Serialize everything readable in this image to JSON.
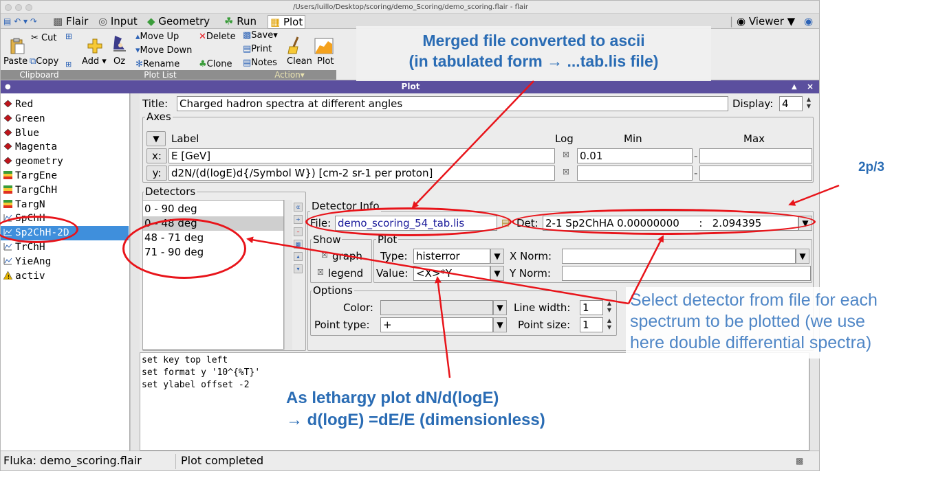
{
  "window": {
    "title": "/Users/luillo/Desktop/scoring/demo_Scoring/demo_scoring.flair - flair",
    "panel_title": "Plot"
  },
  "menubar": {
    "items": [
      "Flair",
      "Input",
      "Geometry",
      "Run",
      "Plot"
    ],
    "viewer": "Viewer"
  },
  "ribbon": {
    "clipboard": {
      "cut": "Cut",
      "paste": "Paste",
      "copy": "Copy",
      "label": "Clipboard"
    },
    "plotlist": {
      "add": "Add",
      "oz": "Oz",
      "move_up": "Move Up",
      "move_down": "Move Down",
      "rename": "Rename",
      "delete": "Delete",
      "clone": "Clone",
      "label": "Plot List"
    },
    "action": {
      "save": "Save",
      "print": "Print",
      "notes": "Notes",
      "clean": "Clean",
      "plot": "Plot",
      "label": "Action"
    }
  },
  "plot_list": [
    {
      "label": "Red",
      "icon": "red-dot-icon",
      "color": "#c0141b"
    },
    {
      "label": "Green",
      "icon": "green-dot-icon",
      "color": "#c0141b"
    },
    {
      "label": "Blue",
      "icon": "blue-dot-icon",
      "color": "#c0141b"
    },
    {
      "label": "Magenta",
      "icon": "magenta-dot-icon",
      "color": "#c0141b"
    },
    {
      "label": "geometry",
      "icon": "geometry-dot-icon",
      "color": "#c0141b"
    },
    {
      "label": "TargEne",
      "icon": "usrbin-icon",
      "color": "#e03020"
    },
    {
      "label": "TargChH",
      "icon": "usrbin-icon",
      "color": "#e03020"
    },
    {
      "label": "TargN",
      "icon": "usrbin-icon",
      "color": "#e03020"
    },
    {
      "label": "SpChH",
      "icon": "line-plot-icon",
      "color": "#2d63b6"
    },
    {
      "label": "Sp2ChH-2D",
      "icon": "line-plot-icon",
      "color": "#2d63b6"
    },
    {
      "label": "TrChH",
      "icon": "line-plot-icon",
      "color": "#2d63b6"
    },
    {
      "label": "YieAng",
      "icon": "line-plot-icon",
      "color": "#2d63b6"
    },
    {
      "label": "activ",
      "icon": "warning-icon",
      "color": "#e0b000"
    }
  ],
  "plot_form": {
    "title_label": "Title:",
    "title_value": "Charged hadron spectra at different angles",
    "display_label": "Display:",
    "display_value": "4",
    "axes": {
      "frame_label": "Axes",
      "col_label": "Label",
      "col_log": "Log",
      "col_min": "Min",
      "col_max": "Max",
      "x_label": "x:",
      "x_value": "E [GeV]",
      "x_min": "0.01",
      "y_label": "y:",
      "y_value": "d2N/(d(logE)d{/Symbol W}) [cm-2 sr-1 per proton]"
    },
    "detectors": {
      "frame_label": "Detectors",
      "items": [
        "0 - 90 deg",
        "0 - 48 deg",
        "48 - 71 deg",
        "71 - 90 deg"
      ]
    },
    "detector_info": {
      "frame_label": "Detector Info",
      "file_label": "File:",
      "file_value": "demo_scoring_54_tab.lis",
      "det_label": "Det:",
      "det_value": "2-1 Sp2ChHA 0.00000000      :   2.094395",
      "show_label": "Show",
      "graph": "graph",
      "legend": "legend",
      "plot_label": "Plot",
      "type_label": "Type:",
      "type_value": "histerror",
      "value_label": "Value:",
      "value_value": "<X>*Y",
      "xnorm_label": "X Norm:",
      "ynorm_label": "Y Norm:",
      "options_label": "Options",
      "color_label": "Color:",
      "linewidth_label": "Line width:",
      "linewidth_value": "1",
      "pointtype_label": "Point type:",
      "pointtype_value": "+",
      "pointsize_label": "Point size:",
      "pointsize_value": "1"
    },
    "commands": [
      "set key top left",
      "set format y '10^{%T}'",
      "set ylabel offset -2"
    ]
  },
  "status": {
    "file": "Fluka: demo_scoring.flair",
    "message": "Plot completed"
  },
  "annotations": {
    "merged_line1": "Merged file converted to ascii",
    "merged_line2": "(in tabulated form → ...tab.lis file)",
    "two_pi": "2p/3",
    "select_line1": "Select detector from file for each",
    "select_line2": "spectrum to be plotted (we use",
    "select_line3": "here double differential spectra)",
    "lethargy_line1": "As lethargy plot dN/d(logE)",
    "lethargy_line2": "→ d(logE) =dE/E (dimensionless)"
  },
  "colors": {
    "annotation_red": "#e8141a",
    "annotation_blue": "#2a6cb4",
    "selection_blue": "#3f8fdc",
    "panel_purple": "#5b4f9e"
  }
}
